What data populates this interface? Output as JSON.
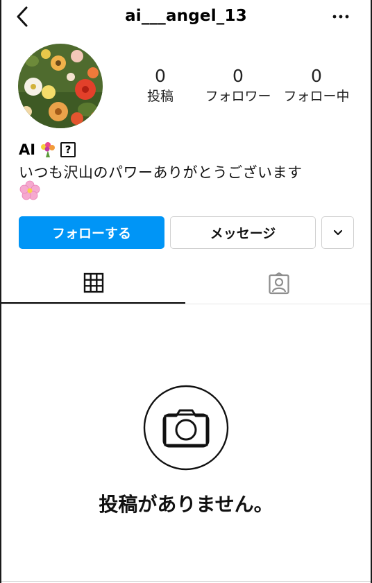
{
  "header": {
    "username": "ai___angel_13",
    "back_icon": "chevron-left-icon",
    "more_icon": "more-horizontal-icon"
  },
  "stats": [
    {
      "num": "0",
      "label": "投稿"
    },
    {
      "num": "0",
      "label": "フォロワー"
    },
    {
      "num": "0",
      "label": "フォロー中"
    }
  ],
  "bio": {
    "name": "AI",
    "name_emoji": "bouquet-emoji",
    "name_badge": "?",
    "text": "いつも沢山のパワーありがとうございます",
    "trailing_emoji": "cherry-blossom-emoji"
  },
  "actions": {
    "follow_label": "フォローする",
    "message_label": "メッセージ",
    "more_icon": "chevron-down-icon"
  },
  "tabs": [
    {
      "name": "grid",
      "icon": "grid-icon",
      "active": true
    },
    {
      "name": "tagged",
      "icon": "tagged-person-icon",
      "active": false
    }
  ],
  "empty": {
    "icon": "camera-icon",
    "message": "投稿がありません。"
  },
  "colors": {
    "accent": "#0095f6"
  }
}
